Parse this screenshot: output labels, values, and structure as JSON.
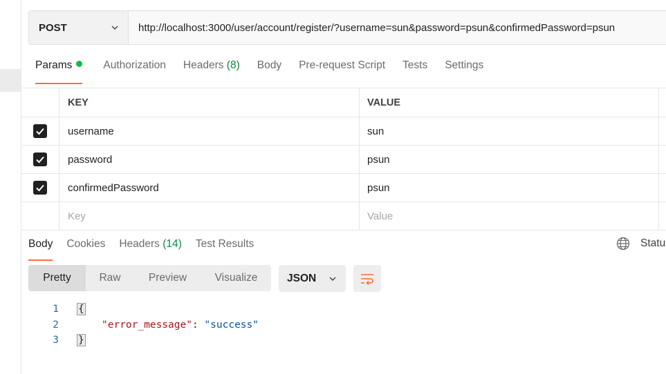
{
  "request": {
    "method": "POST",
    "url": "http://localhost:3000/user/account/register/?username=sun&password=psun&confirmedPassword=psun"
  },
  "request_tabs": [
    {
      "label": "Params",
      "active": true,
      "has_dot": true
    },
    {
      "label": "Authorization"
    },
    {
      "label": "Headers",
      "count": "(8)"
    },
    {
      "label": "Body"
    },
    {
      "label": "Pre-request Script"
    },
    {
      "label": "Tests"
    },
    {
      "label": "Settings"
    }
  ],
  "params": {
    "headers": {
      "key": "KEY",
      "value": "VALUE"
    },
    "rows": [
      {
        "checked": true,
        "key": "username",
        "value": "sun"
      },
      {
        "checked": true,
        "key": "password",
        "value": "psun"
      },
      {
        "checked": true,
        "key": "confirmedPassword",
        "value": "psun"
      }
    ],
    "placeholder": {
      "key": "Key",
      "value": "Value"
    }
  },
  "response_tabs": [
    {
      "label": "Body",
      "active": true
    },
    {
      "label": "Cookies"
    },
    {
      "label": "Headers",
      "count": "(14)"
    },
    {
      "label": "Test Results"
    }
  ],
  "status_label": "Statu",
  "view_modes": [
    "Pretty",
    "Raw",
    "Preview",
    "Visualize"
  ],
  "active_view_mode": "Pretty",
  "format": "JSON",
  "code": {
    "line_numbers": [
      "1",
      "2",
      "3"
    ],
    "open_brace": "{",
    "close_brace": "}",
    "key": "\"error_message\"",
    "colon": ": ",
    "value": "\"success\""
  },
  "colors": {
    "accent": "#ff6c37",
    "dot_green": "#0cbb52",
    "json_key": "#a31515",
    "json_string": "#0451a5"
  },
  "icons": [
    "chevron-down-icon",
    "globe-icon",
    "wrap-lines-icon",
    "checkbox-checked-icon"
  ]
}
